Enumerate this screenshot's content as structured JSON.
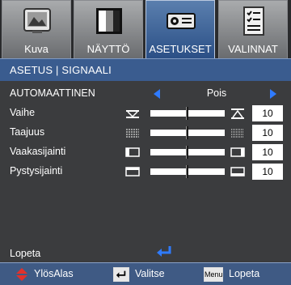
{
  "tabs": [
    {
      "label": "Kuva",
      "icon": "picture-icon",
      "active": false
    },
    {
      "label": "NÄYTTÖ",
      "icon": "display-icon",
      "active": false
    },
    {
      "label": "ASETUKSET",
      "icon": "projector-icon",
      "active": true
    },
    {
      "label": "VALINNAT",
      "icon": "checklist-icon",
      "active": false
    }
  ],
  "header": {
    "title": "ASETUS | SIGNAALI"
  },
  "automatic": {
    "label": "AUTOMAATTINEN",
    "value": "Pois"
  },
  "settings": [
    {
      "label": "Vaihe",
      "value": "10",
      "level": 0.5,
      "icon_left": "phase-icon",
      "icon_right": "phase-icon"
    },
    {
      "label": "Taajuus",
      "value": "10",
      "level": 0.5,
      "icon_left": "frequency-icon",
      "icon_right": "frequency-icon"
    },
    {
      "label": "Vaakasijainti",
      "value": "10",
      "level": 0.5,
      "icon_left": "horizontal-position-icon",
      "icon_right": "horizontal-position-icon"
    },
    {
      "label": "Pystysijainti",
      "value": "10",
      "level": 0.5,
      "icon_left": "vertical-position-icon",
      "icon_right": "vertical-position-icon"
    }
  ],
  "exit": {
    "label": "Lopeta",
    "icon": "enter-icon"
  },
  "footer": {
    "updown_label": "YlösAlas",
    "select_label": "Valitse",
    "menu_key": "Menu",
    "exit_label": "Lopeta"
  },
  "colors": {
    "accent": "#2f7bff",
    "header": "#3a5c8f",
    "background": "#3b3c3e",
    "footer": "#3f5a84",
    "updown": "#e2312b"
  }
}
